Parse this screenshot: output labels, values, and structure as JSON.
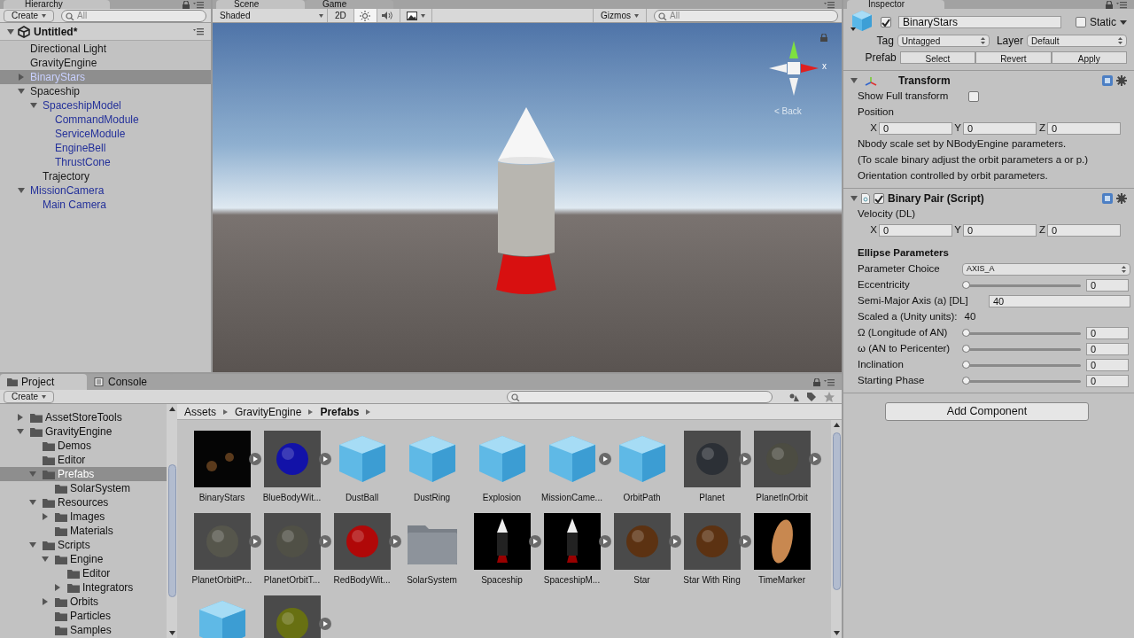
{
  "hierarchy": {
    "tab": "Hierarchy",
    "create": "Create",
    "search_placeholder": "All",
    "scene_name": "Untitled*",
    "items": [
      {
        "label": "Directional Light",
        "prefab": false,
        "selected": false
      },
      {
        "label": "GravityEngine",
        "prefab": false,
        "selected": false
      },
      {
        "label": "BinaryStars",
        "prefab": true,
        "selected": true,
        "expanded": false
      },
      {
        "label": "Spaceship",
        "prefab": false,
        "selected": false,
        "expanded": true,
        "children": [
          {
            "label": "SpaceshipModel",
            "prefab": true,
            "selected": false,
            "expanded": true,
            "children": [
              {
                "label": "CommandModule",
                "prefab": true,
                "selected": false
              },
              {
                "label": "ServiceModule",
                "prefab": true,
                "selected": false
              },
              {
                "label": "EngineBell",
                "prefab": true,
                "selected": false
              },
              {
                "label": "ThrustCone",
                "prefab": true,
                "selected": false
              }
            ]
          },
          {
            "label": "Trajectory",
            "prefab": false,
            "selected": false
          }
        ]
      },
      {
        "label": "MissionCamera",
        "prefab": true,
        "selected": false,
        "expanded": true,
        "children": [
          {
            "label": "Main Camera",
            "prefab": true,
            "selected": false
          }
        ]
      }
    ]
  },
  "scene": {
    "tabs": [
      {
        "label": "Scene",
        "selected": true
      },
      {
        "label": "Game",
        "selected": false
      }
    ],
    "shading": "Shaded",
    "mode_2d": "2D",
    "lighting": true,
    "audio": false,
    "gizmos": "Gizmos",
    "search_placeholder": "All",
    "axis_label": "x",
    "view_label": "< Back"
  },
  "inspector": {
    "tab": "Inspector",
    "active": true,
    "name": "BinaryStars",
    "static_label": "Static",
    "static": false,
    "tag_label": "Tag",
    "tag": "Untagged",
    "layer_label": "Layer",
    "layer": "Default",
    "prefab_label": "Prefab",
    "prefab_buttons": [
      "Select",
      "Revert",
      "Apply"
    ],
    "components": [
      {
        "kind": "transform",
        "title": "Transform",
        "expanded": true,
        "rows": [
          {
            "kind": "checkbox",
            "label": "Show Full transform",
            "checked": false
          },
          {
            "kind": "label",
            "label": "Position"
          },
          {
            "kind": "vector",
            "fields": [
              {
                "axis": "X",
                "value": "0"
              },
              {
                "axis": "Y",
                "value": "0"
              },
              {
                "axis": "Z",
                "value": "0"
              }
            ]
          },
          {
            "kind": "note",
            "label": "Nbody scale set by NBodyEngine parameters."
          },
          {
            "kind": "note",
            "label": "(To scale binary adjust the orbit parameters a or p.)"
          },
          {
            "kind": "note",
            "label": "Orientation controlled by orbit parameters."
          }
        ]
      },
      {
        "kind": "script",
        "title": "Binary Pair (Script)",
        "expanded": true,
        "enabled": true,
        "rows": [
          {
            "kind": "label",
            "label": "Velocity (DL)"
          },
          {
            "kind": "vector",
            "fields": [
              {
                "axis": "X",
                "value": "0"
              },
              {
                "axis": "Y",
                "value": "0"
              },
              {
                "axis": "Z",
                "value": "0"
              }
            ]
          },
          {
            "kind": "heading",
            "label": "Ellipse Parameters"
          },
          {
            "kind": "dropdown",
            "label": "Parameter Choice",
            "value": "AXIS_A"
          },
          {
            "kind": "slider",
            "label": "Eccentricity",
            "level": 0,
            "value": "0"
          },
          {
            "kind": "field",
            "label": "Semi-Major Axis (a) [DL]",
            "value": "40"
          },
          {
            "kind": "readout",
            "label": "Scaled a (Unity units):",
            "value": "40"
          },
          {
            "kind": "slider",
            "label": "Ω (Longitude of AN)",
            "level": 0,
            "value": "0"
          },
          {
            "kind": "slider",
            "label": "ω (AN to Pericenter)",
            "level": 0,
            "value": "0"
          },
          {
            "kind": "slider",
            "label": "Inclination",
            "level": 0,
            "value": "0"
          },
          {
            "kind": "slider",
            "label": "Starting Phase",
            "level": 0,
            "value": "0"
          }
        ]
      }
    ],
    "add_component": "Add Component"
  },
  "project": {
    "tabs": [
      {
        "label": "Project",
        "selected": true
      },
      {
        "label": "Console",
        "selected": false
      }
    ],
    "create": "Create",
    "folders": [
      {
        "label": "AssetStoreTools",
        "selected": false,
        "expanded": false
      },
      {
        "label": "GravityEngine",
        "selected": false,
        "expanded": true,
        "children": [
          {
            "label": "Demos",
            "selected": false
          },
          {
            "label": "Editor",
            "selected": false
          },
          {
            "label": "Prefabs",
            "selected": true,
            "expanded": true,
            "children": [
              {
                "label": "SolarSystem",
                "selected": false
              }
            ]
          },
          {
            "label": "Resources",
            "selected": false,
            "expanded": true,
            "children": [
              {
                "label": "Images",
                "selected": false,
                "expanded": false
              },
              {
                "label": "Materials",
                "selected": false
              }
            ]
          },
          {
            "label": "Scripts",
            "selected": false,
            "expanded": true,
            "children": [
              {
                "label": "Engine",
                "selected": false,
                "expanded": true,
                "children": [
                  {
                    "label": "Editor",
                    "selected": false
                  },
                  {
                    "label": "Integrators",
                    "selected": false,
                    "expanded": false
                  }
                ]
              },
              {
                "label": "Orbits",
                "selected": false,
                "expanded": false
              },
              {
                "label": "Particles",
                "selected": false
              },
              {
                "label": "Samples",
                "selected": false
              }
            ]
          }
        ]
      }
    ],
    "breadcrumb": [
      {
        "label": "Assets",
        "current": false
      },
      {
        "label": "GravityEngine",
        "current": false
      },
      {
        "label": "Prefabs",
        "current": true
      }
    ],
    "assets": [
      {
        "label": "BinaryStars",
        "kind": "binary",
        "has_children": true
      },
      {
        "label": "BlueBodyWit...",
        "kind": "sphere",
        "color": "#1212a8",
        "has_children": true
      },
      {
        "label": "DustBall",
        "kind": "cube",
        "has_children": false
      },
      {
        "label": "DustRing",
        "kind": "cube",
        "has_children": false
      },
      {
        "label": "Explosion",
        "kind": "cube",
        "has_children": false
      },
      {
        "label": "MissionCame...",
        "kind": "cube",
        "has_children": true
      },
      {
        "label": "OrbitPath",
        "kind": "cube",
        "has_children": false
      },
      {
        "label": "Planet",
        "kind": "sphere",
        "color": "#2c3036",
        "has_children": true
      },
      {
        "label": "PlanetInOrbit",
        "kind": "sphere",
        "color": "#4c4c42",
        "has_children": true
      },
      {
        "label": "PlanetOrbitPr...",
        "kind": "sphere",
        "color": "#56564c",
        "has_children": true
      },
      {
        "label": "PlanetOrbitT...",
        "kind": "sphere",
        "color": "#505046",
        "has_children": true
      },
      {
        "label": "RedBodyWit...",
        "kind": "sphere",
        "color": "#b00808",
        "has_children": true
      },
      {
        "label": "SolarSystem",
        "kind": "folder",
        "has_children": false
      },
      {
        "label": "Spaceship",
        "kind": "rocket",
        "has_children": true
      },
      {
        "label": "SpaceshipM...",
        "kind": "rocket",
        "has_children": true
      },
      {
        "label": "Star",
        "kind": "sphere",
        "color": "#5c3212",
        "has_children": true
      },
      {
        "label": "Star With Ring",
        "kind": "sphere",
        "color": "#5c3212",
        "has_children": true
      },
      {
        "label": "TimeMarker",
        "kind": "disc",
        "has_children": false
      },
      {
        "kind": "cube",
        "has_children": false
      },
      {
        "kind": "sphere",
        "color": "#687012",
        "has_children": true
      }
    ]
  }
}
